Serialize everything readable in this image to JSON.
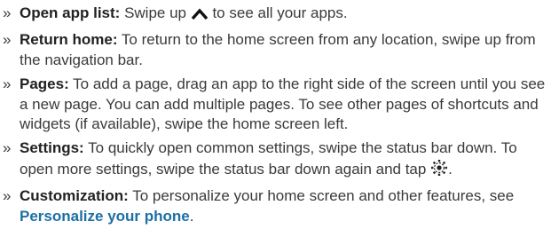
{
  "items": [
    {
      "marker": "»",
      "term": "Open app list:",
      "text_before_icon": " Swipe up ",
      "icon": "chevron-up-icon",
      "text_after_icon": " to see all your apps."
    },
    {
      "marker": "»",
      "term": "Return home:",
      "text": " To return to the home screen from any location, swipe up from the navigation bar."
    },
    {
      "marker": "»",
      "term": "Pages:",
      "text": " To add a page, drag an app to the right side of the screen until you see a new page. You can add multiple pages. To see other pages of shortcuts and widgets (if available), swipe the home screen left."
    },
    {
      "marker": "»",
      "term": "Settings:",
      "text_before_icon": " To quickly open common settings, swipe the status bar down. To open more settings, swipe the status bar down again and tap ",
      "icon": "settings-gear-icon",
      "text_after_icon": "."
    },
    {
      "marker": "»",
      "term": "Customization:",
      "text_before_link": " To personalize your home screen and other features, see ",
      "link": "Personalize your phone",
      "text_after_link": "."
    }
  ]
}
